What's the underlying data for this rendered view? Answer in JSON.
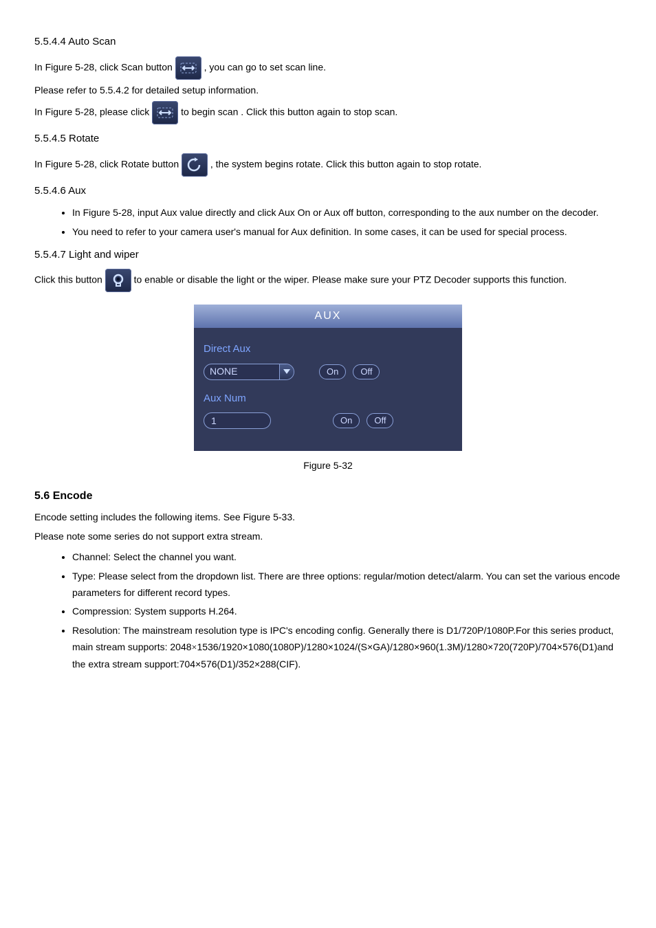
{
  "section1": {
    "title": "5.5.4.4 Auto Scan",
    "scan_line": "In Figure 5-28, click Scan button ",
    "scan_line2": ", you can go to set scan line.",
    "icon_hint": "Please refer to 5.5.4.2 for detailed setup information.",
    "scan_start_prefix": "In Figure 5-28, please click ",
    "scan_start_suffix": " to begin scan . Click this button again to stop scan.",
    "rotate_title": "5.5.4.5 Rotate",
    "rotate_prefix": "In Figure 5-28, click Rotate button ",
    "rotate_suffix": ", the system begins rotate. Click this button again to stop rotate.",
    "aux_title": "5.5.4.6 Aux",
    "aux_bullet1": "In Figure 5-28, input Aux value directly and click Aux On or Aux off button, corresponding to the aux number on the decoder.",
    "aux_bullet2": "You need to refer to your camera user's manual for Aux definition. In some cases, it can be used for special process.",
    "light_title": "5.5.4.7 Light and wiper",
    "light_prefix": "Click this button ",
    "light_suffix": " to enable or disable the light or the wiper. Please make sure your PTZ Decoder supports this function."
  },
  "aux_panel": {
    "header": "AUX",
    "label1": "Direct Aux",
    "select_value": "NONE",
    "on": "On",
    "off": "Off",
    "label2": "Aux Num",
    "num": "1"
  },
  "figure_caption": "Figure 5-32",
  "encode": {
    "heading": "5.6 Encode",
    "intro": "Encode setting includes the following items. See Figure 5-33.",
    "note": "Please note some series do not support extra stream.",
    "b1": "Channel: Select the channel you want.",
    "b2": "Type: Please select from the dropdown list. There are three options: regular/motion detect/alarm. You can set the various encode parameters for different record types.",
    "b3": "Compression: System supports H.264.",
    "b4_prefix": "Resolution: The ",
    "b4_mid": "mainstream resolution type is IPC's encoding config. Generally there is",
    "res_line": "D1/720P/1080P.For this series product, main stream supports: 2048",
    "res_x": "×",
    "res_detail": "1536/1920×1080(1080P)/1280×1024/(S×GA)/1280×960(1.3M)/1280×720(720P)/704×576(D1)and the extra stream support:704×576(D1)/352×288(CIF)."
  }
}
